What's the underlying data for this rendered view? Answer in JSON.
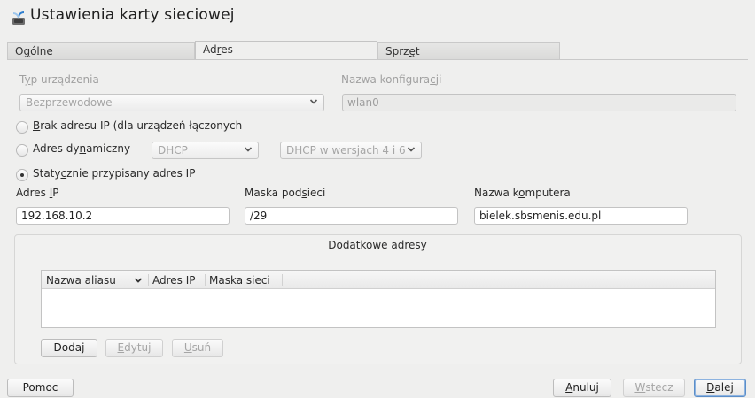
{
  "window": {
    "title": "Ustawienia karty sieciowej"
  },
  "tabs": [
    {
      "label_pre": "O",
      "label_ul": "g",
      "label_post": "ólne"
    },
    {
      "label_pre": "Ad",
      "label_ul": "r",
      "label_post": "es"
    },
    {
      "label_pre": "Sprz",
      "label_ul": "ę",
      "label_post": "t"
    }
  ],
  "device_type": {
    "label_pre": "T",
    "label_ul": "y",
    "label_post": "p urządzenia",
    "value": "Bezprzewodowe"
  },
  "config_name": {
    "label_pre": "Nazwa konfigura",
    "label_ul": "c",
    "label_post": "ji",
    "value": "wlan0"
  },
  "radio_no_ip": {
    "label_pre": "",
    "label_ul": "B",
    "label_post": "rak adresu IP (dla urządzeń łączonych",
    "checked": false
  },
  "radio_dynamic": {
    "label_pre": "Adres dy",
    "label_ul": "n",
    "label_post": "amiczny",
    "checked": false,
    "mode": "DHCP",
    "versions": "DHCP w wersjach 4 i 6"
  },
  "radio_static": {
    "label_pre": "Staty",
    "label_ul": "c",
    "label_post": "znie przypisany adres IP",
    "checked": true
  },
  "ip_address": {
    "label_pre": "Adres ",
    "label_ul": "I",
    "label_post": "P",
    "value": "192.168.10.2"
  },
  "netmask": {
    "label_pre": "Maska pod",
    "label_ul": "s",
    "label_post": "ieci",
    "value": "/29"
  },
  "hostname": {
    "label_pre": "Nazwa k",
    "label_ul": "o",
    "label_post": "mputera",
    "value": "bielek.sbsmenis.edu.pl"
  },
  "additional": {
    "title": "Dodatkowe adresy",
    "columns": [
      "Nazwa aliasu",
      "Adres IP",
      "Maska sieci"
    ],
    "rows": [],
    "add_label": "Dodaj",
    "edit_label_pre": "",
    "edit_label_ul": "E",
    "edit_label_post": "dytuj",
    "delete_label_pre": "",
    "delete_label_ul": "U",
    "delete_label_post": "suń"
  },
  "footer": {
    "help_label": "Pomoc",
    "cancel_pre": "",
    "cancel_ul": "A",
    "cancel_post": "nuluj",
    "back_pre": "",
    "back_ul": "W",
    "back_post": "stecz",
    "next_pre": "",
    "next_ul": "D",
    "next_post": "alej"
  },
  "colors": {
    "background": "#efefee",
    "focus_accent": "#5b8ec9",
    "disabled_text": "#a0a0a0"
  },
  "icons": {
    "title": "network-card-icon",
    "combo": "chevron-down-icon",
    "column_sort": "chevron-down-icon"
  }
}
